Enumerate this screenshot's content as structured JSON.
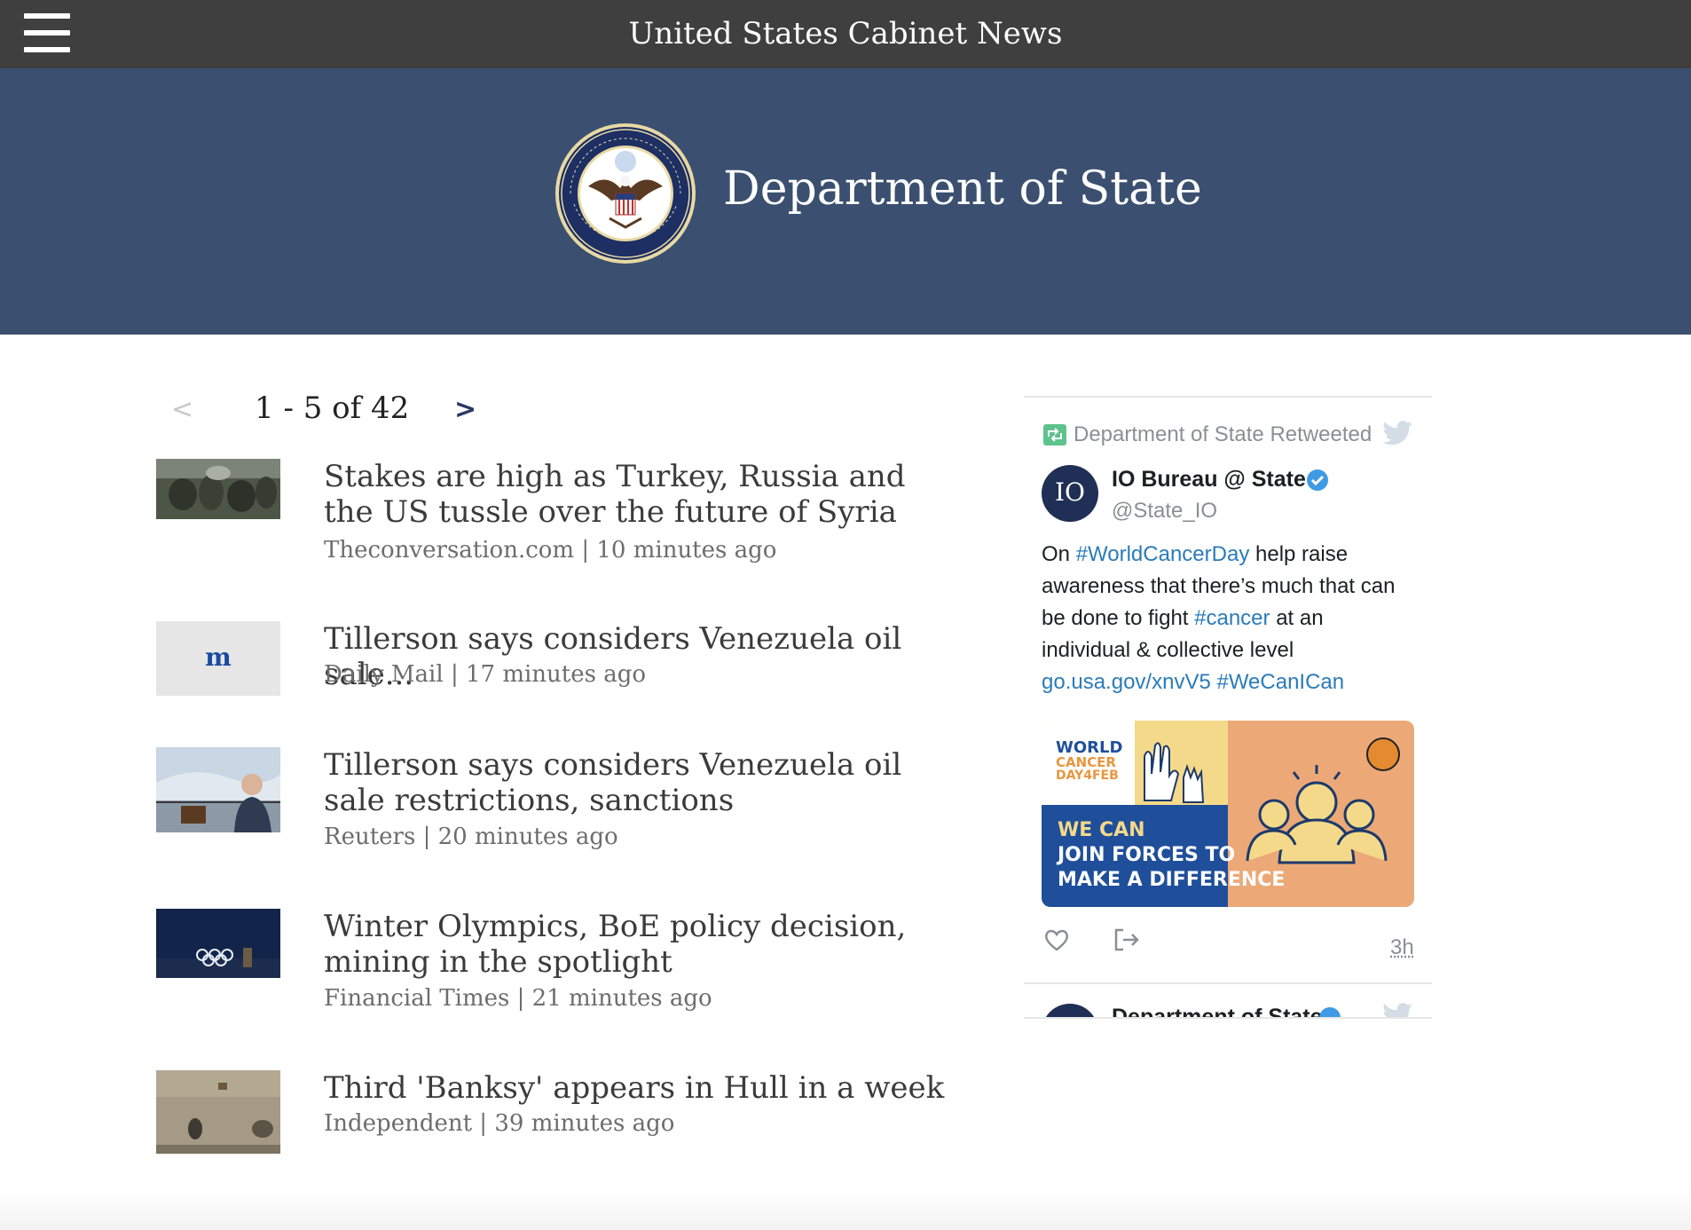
{
  "header": {
    "app_title": "United States Cabinet News",
    "menu_icon": "hamburger-menu-icon"
  },
  "hero": {
    "department": "Department of State",
    "seal_icon": "department-of-state-seal",
    "background": "#3b5070"
  },
  "pager": {
    "prev": "<",
    "range": "1 - 5 of 42",
    "next": ">"
  },
  "articles": [
    {
      "headline": "Stakes are high as Turkey, Russia and the US tussle over the future of Syria",
      "source": "Theconversation.com",
      "time": "10 minutes ago",
      "thumbnail": "soldiers-photo"
    },
    {
      "headline": "Tillerson says considers Venezuela oil sale...",
      "source": "Daily Mail",
      "time": "17 minutes ago",
      "thumbnail": "daily-mail-logo"
    },
    {
      "headline": "Tillerson says considers Venezuela oil sale restrictions, sanctions",
      "source": "Reuters",
      "time": "20 minutes ago",
      "thumbnail": "tillerson-photo"
    },
    {
      "headline": "Winter Olympics, BoE policy decision, mining in the spotlight",
      "source": "Financial Times",
      "time": "21 minutes ago",
      "thumbnail": "olympic-rings-photo"
    },
    {
      "headline": "Third 'Banksy' appears in Hull in a week",
      "source": "Independent",
      "time": "39 minutes ago",
      "thumbnail": "banksy-wall-photo"
    }
  ],
  "tweet": {
    "retweeted_by": "Department of State Retweeted",
    "author_name": "IO Bureau @ State",
    "author_handle": "@State_IO",
    "avatar_text": "IO",
    "text_parts": {
      "t1": "On ",
      "hashtag1": "#WorldCancerDay",
      "t2": " help raise awareness that there’s much that can be done to fight ",
      "hashtag2": "#cancer",
      "t3": " at an individual & collective level ",
      "link": "go.usa.gov/xnvV5",
      "t4": " ",
      "hashtag3": "#WeCanICan"
    },
    "media": {
      "line1": "WORLD",
      "line2": "CANCER",
      "line3": "DAY4FEB",
      "slogan1": "WE CAN",
      "slogan2": "JOIN FORCES TO",
      "slogan3": "MAKE A DIFFERENCE"
    },
    "time": "3h",
    "icons": [
      "retweet-icon",
      "twitter-bird-icon",
      "verified-icon",
      "heart-icon",
      "share-icon"
    ],
    "next_author": "Department of State"
  },
  "colors": {
    "topbar": "#3f3f3f",
    "hero": "#3b5070",
    "link": "#2b7bb9"
  }
}
